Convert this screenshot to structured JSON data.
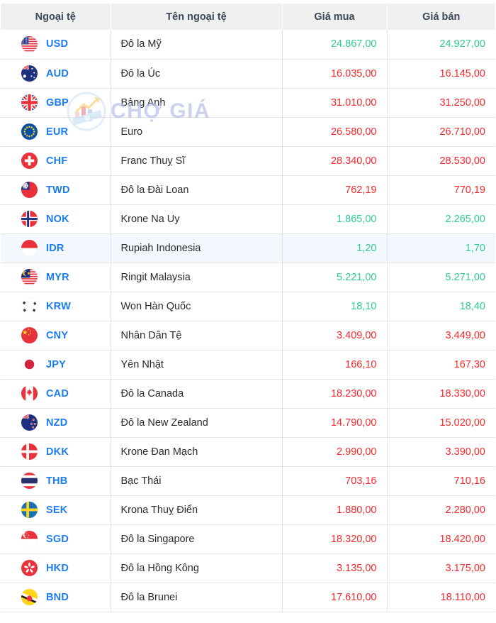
{
  "table": {
    "headers": {
      "code": "Ngoại tệ",
      "name": "Tên ngoại tệ",
      "buy": "Giá mua",
      "sell": "Giá bán"
    },
    "rows": [
      {
        "code": "USD",
        "flag": "flag-us",
        "name": "Đô la Mỹ",
        "buy": "24.867,00",
        "sell": "24.927,00",
        "buy_dir": "up",
        "sell_dir": "up",
        "highlight": false
      },
      {
        "code": "AUD",
        "flag": "flag-au",
        "name": "Đô la Úc",
        "buy": "16.035,00",
        "sell": "16.145,00",
        "buy_dir": "down",
        "sell_dir": "down",
        "highlight": false
      },
      {
        "code": "GBP",
        "flag": "flag-gb",
        "name": "Bảng Anh",
        "buy": "31.010,00",
        "sell": "31.250,00",
        "buy_dir": "down",
        "sell_dir": "down",
        "highlight": false
      },
      {
        "code": "EUR",
        "flag": "flag-eu",
        "name": "Euro",
        "buy": "26.580,00",
        "sell": "26.710,00",
        "buy_dir": "down",
        "sell_dir": "down",
        "highlight": false
      },
      {
        "code": "CHF",
        "flag": "flag-ch",
        "name": "Franc Thuỵ Sĩ",
        "buy": "28.340,00",
        "sell": "28.530,00",
        "buy_dir": "down",
        "sell_dir": "down",
        "highlight": false
      },
      {
        "code": "TWD",
        "flag": "flag-tw",
        "name": "Đô la Đài Loan",
        "buy": "762,19",
        "sell": "770,19",
        "buy_dir": "down",
        "sell_dir": "down",
        "highlight": false
      },
      {
        "code": "NOK",
        "flag": "flag-no",
        "name": "Krone Na Uy",
        "buy": "1.865,00",
        "sell": "2.265,00",
        "buy_dir": "up",
        "sell_dir": "up",
        "highlight": false
      },
      {
        "code": "IDR",
        "flag": "flag-id",
        "name": "Rupiah Indonesia",
        "buy": "1,20",
        "sell": "1,70",
        "buy_dir": "up",
        "sell_dir": "up",
        "highlight": true
      },
      {
        "code": "MYR",
        "flag": "flag-my",
        "name": "Ringit Malaysia",
        "buy": "5.221,00",
        "sell": "5.271,00",
        "buy_dir": "up",
        "sell_dir": "up",
        "highlight": false
      },
      {
        "code": "KRW",
        "flag": "flag-kr",
        "name": "Won Hàn Quốc",
        "buy": "18,10",
        "sell": "18,40",
        "buy_dir": "up",
        "sell_dir": "up",
        "highlight": false
      },
      {
        "code": "CNY",
        "flag": "flag-cn",
        "name": "Nhân Dân Tệ",
        "buy": "3.409,00",
        "sell": "3.449,00",
        "buy_dir": "down",
        "sell_dir": "down",
        "highlight": false
      },
      {
        "code": "JPY",
        "flag": "flag-jp",
        "name": "Yên Nhật",
        "buy": "166,10",
        "sell": "167,30",
        "buy_dir": "down",
        "sell_dir": "down",
        "highlight": false
      },
      {
        "code": "CAD",
        "flag": "flag-ca",
        "name": "Đô la Canada",
        "buy": "18.230,00",
        "sell": "18.330,00",
        "buy_dir": "down",
        "sell_dir": "down",
        "highlight": false
      },
      {
        "code": "NZD",
        "flag": "flag-nz",
        "name": "Đô la New Zealand",
        "buy": "14.790,00",
        "sell": "15.020,00",
        "buy_dir": "down",
        "sell_dir": "down",
        "highlight": false
      },
      {
        "code": "DKK",
        "flag": "flag-dk",
        "name": "Krone Đan Mạch",
        "buy": "2.990,00",
        "sell": "3.390,00",
        "buy_dir": "down",
        "sell_dir": "down",
        "highlight": false
      },
      {
        "code": "THB",
        "flag": "flag-th",
        "name": "Bạc Thái",
        "buy": "703,16",
        "sell": "710,16",
        "buy_dir": "down",
        "sell_dir": "down",
        "highlight": false
      },
      {
        "code": "SEK",
        "flag": "flag-se",
        "name": "Krona Thuỵ Điển",
        "buy": "1.880,00",
        "sell": "2.280,00",
        "buy_dir": "down",
        "sell_dir": "down",
        "highlight": false
      },
      {
        "code": "SGD",
        "flag": "flag-sg",
        "name": "Đô la Singapore",
        "buy": "18.320,00",
        "sell": "18.420,00",
        "buy_dir": "down",
        "sell_dir": "down",
        "highlight": false
      },
      {
        "code": "HKD",
        "flag": "flag-hk",
        "name": "Đô la Hồng Kông",
        "buy": "3.135,00",
        "sell": "3.175,00",
        "buy_dir": "down",
        "sell_dir": "down",
        "highlight": false
      },
      {
        "code": "BND",
        "flag": "flag-bn",
        "name": "Đô la Brunei",
        "buy": "17.610,00",
        "sell": "18.110,00",
        "buy_dir": "down",
        "sell_dir": "down",
        "highlight": false
      }
    ]
  },
  "watermark": {
    "text": "CHỢ GIÁ",
    "logo_icon": "chart-wallet-logo-icon"
  },
  "colors": {
    "code_blue": "#1a7cf0",
    "price_up_green": "#2ecb96",
    "price_down_red": "#f6292c",
    "header_bg": "#f0f0f0",
    "header_text": "#3c4858",
    "row_highlight": "#f2f8fd",
    "border": "#e4e4e4"
  }
}
